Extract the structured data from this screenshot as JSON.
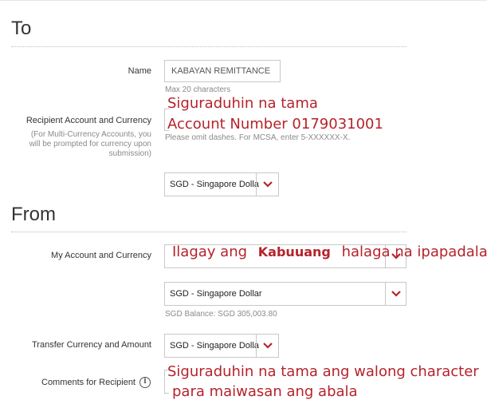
{
  "to": {
    "title": "To",
    "name_label": "Name",
    "name_value": "KABAYAN REMITTANCE",
    "name_hint": "Max 20 characters",
    "recipient_label": "Recipient Account and Currency",
    "recipient_sublabel_1": "(For Multi-Currency Accounts, you",
    "recipient_sublabel_2": "will be prompted for currency upon",
    "recipient_sublabel_3": "submission)",
    "account_hint": "Please omit dashes. For MCSA, enter 5-XXXXXX-X.",
    "currency_select": "SGD - Singapore Dollar",
    "overlay_line1": "Siguraduhin na tama",
    "overlay_line2": "Account Number 0179031001"
  },
  "from": {
    "title": "From",
    "my_account_label": "My Account and Currency",
    "my_account_overlay_1": "Ilagay ang",
    "my_account_overlay_bold": "Kabuuang",
    "my_account_overlay_2": "halaga na ipapadala",
    "account_currency_select": "SGD - Singapore Dollar",
    "balance": "SGD Balance: SGD 305,003.80",
    "transfer_label": "Transfer Currency and Amount",
    "transfer_select": "SGD - Singapore Dollar",
    "comments_label": "Comments for Recipient",
    "comments_overlay_1": "Siguraduhin na tama ang walong character",
    "comments_overlay_2": "para maiwasan ang abala"
  },
  "colors": {
    "accent": "#b5232b",
    "border": "#c8c8c8"
  },
  "icons": {
    "chevron": "chevron-down-icon",
    "info": "info-icon"
  }
}
